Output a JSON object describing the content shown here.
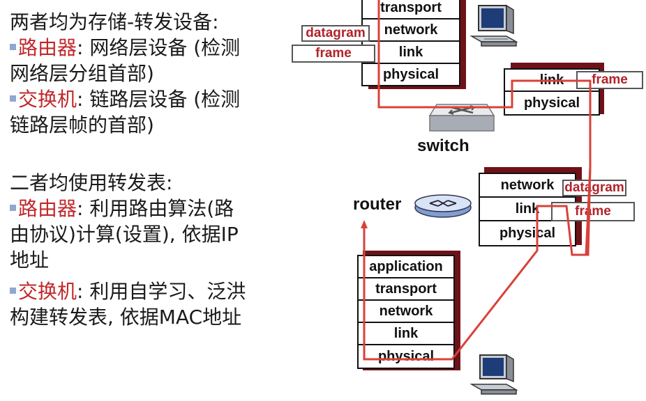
{
  "left_text": {
    "para1": {
      "heading": "两者均为存储-转发设备:",
      "b1_red": "路由器",
      "b1_rest": ": 网络层设备 (检测",
      "b1_cont": "网络层分组首部)",
      "b2_red": "交换机",
      "b2_rest": ": 链路层设备 (检测",
      "b2_cont": "链路层帧的首部)"
    },
    "para2": {
      "heading": "二者均使用转发表:",
      "b1_red": "路由器",
      "b1_rest": ": 利用路由算法(路",
      "b1_cont1": "由协议)计算(设置), 依据IP",
      "b1_cont2": "地址",
      "b2_red": "交换机",
      "b2_rest": ": 利用自学习、泛洪",
      "b2_cont": "构建转发表, 依据MAC地址"
    }
  },
  "diagram": {
    "top_host_stack": [
      "transport",
      "network",
      "link",
      "physical"
    ],
    "top_tags": [
      "datagram",
      "frame"
    ],
    "switch_stack": [
      "link",
      "physical"
    ],
    "switch_tag": "frame",
    "switch_label": "switch",
    "router_stack": [
      "network",
      "link",
      "physical"
    ],
    "router_tags": [
      "datagram",
      "frame"
    ],
    "router_label": "router",
    "bottom_host_stack": [
      "application",
      "transport",
      "network",
      "link",
      "physical"
    ]
  }
}
